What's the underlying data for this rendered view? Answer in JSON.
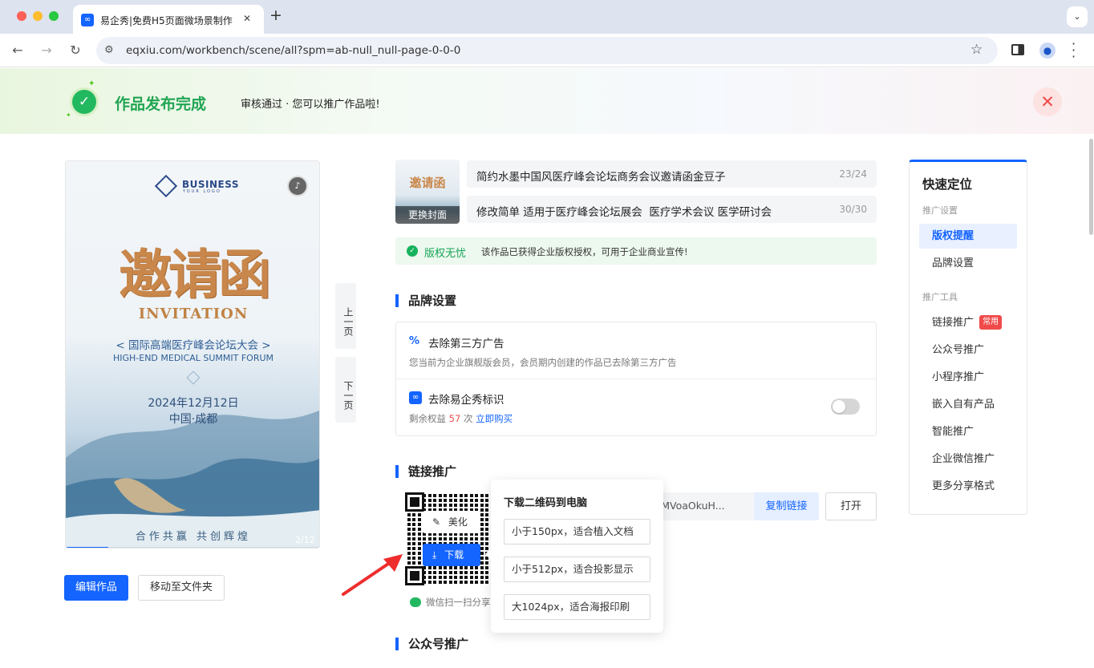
{
  "browser": {
    "tab_title": "易企秀|免费H5页面微场景制作",
    "tab_close": "✕",
    "new_tab": "+",
    "url": "eqxiu.com/workbench/scene/all?spm=ab-null_null-page-0-0-0"
  },
  "banner": {
    "title": "作品发布完成",
    "subtitle": "审核通过 · 您可以推广作品啦!"
  },
  "preview": {
    "brand": "BUSINESS",
    "brand_sub": "YOUR LOGO",
    "headline": "邀请函",
    "invitation": "INVITATION",
    "event_cn": "< 国际高端医疗峰会论坛大会 >",
    "event_en": "HIGH-END MEDICAL SUMMIT FORUM",
    "date": "2024年12月12日",
    "location": "中国·成都",
    "slogan": "合作共赢  共创辉煌",
    "page_counter": "2/12",
    "progress": 0.167
  },
  "pager": {
    "prev": "上一页",
    "next": "下一页"
  },
  "actions": {
    "edit": "编辑作品",
    "move": "移动至文件夹"
  },
  "work": {
    "cover_label": "更换封面",
    "cover_title": "邀请函",
    "title": "简约水墨中国风医疗峰会论坛商务会议邀请函金豆子",
    "title_count": "23/24",
    "desc": "修改简单 适用于医疗峰会论坛展会  医疗学术会议 医学研讨会",
    "desc_count": "30/30",
    "copyright_label": "版权无忧",
    "copyright_text": "该作品已获得企业版权授权，可用于企业商业宣传!"
  },
  "brand_settings": {
    "heading": "品牌设置",
    "ads_title": "去除第三方广告",
    "ads_desc": "您当前为企业旗舰版会员，会员期内创建的作品已去除第三方广告",
    "mark_title": "去除易企秀标识",
    "mark_prefix": "剩余权益",
    "mark_count": "57",
    "mark_unit": "次",
    "mark_buy": "立即购买",
    "toggle_on": false
  },
  "link_promo": {
    "heading": "链接推广",
    "link_text": "/MVoaOkuH...",
    "copy_btn": "复制链接",
    "open_btn": "打开",
    "beautify": "美化",
    "download": "下载",
    "wechat_hint": "微信扫一扫分享"
  },
  "download_menu": {
    "title": "下载二维码到电脑",
    "options": [
      "小于150px，适合植入文档",
      "小于512px，适合投影显示",
      "大1024px，适合海报印刷"
    ]
  },
  "wechat_section": {
    "heading": "公众号推广"
  },
  "quick_nav": {
    "title": "快速定位",
    "group1": "推广设置",
    "group1_items": [
      "版权提醒",
      "品牌设置"
    ],
    "group2": "推广工具",
    "group2_items": [
      "链接推广",
      "公众号推广",
      "小程序推广",
      "嵌入自有产品",
      "智能推广",
      "企业微信推广",
      "更多分享格式"
    ],
    "badge": "常用",
    "active": "版权提醒"
  },
  "colors": {
    "accent": "#1464ff",
    "success": "#15b25c",
    "danger": "#f04a4a"
  }
}
